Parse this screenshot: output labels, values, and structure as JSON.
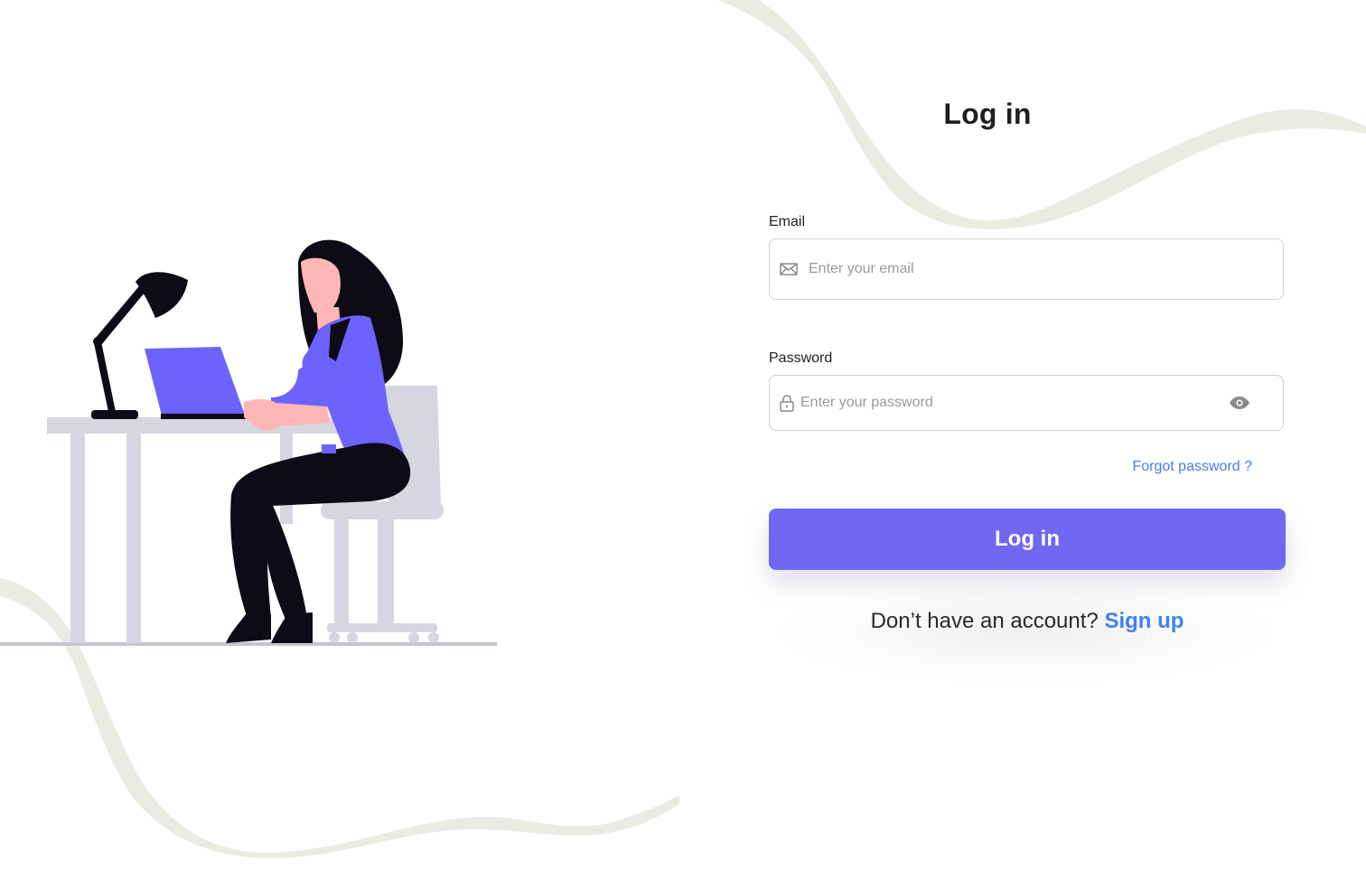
{
  "page": {
    "title": "Log in"
  },
  "form": {
    "email": {
      "label": "Email",
      "placeholder": "Enter your email",
      "value": "",
      "icon": "mail-icon"
    },
    "password": {
      "label": "Password",
      "placeholder": "Enter your password",
      "value": "",
      "icon": "lock-icon",
      "toggle_icon": "eye-icon"
    },
    "forgot_password": "Forgot password ?",
    "submit_label": "Log in",
    "signup_prompt": "Don’t have an account?",
    "signup_link": "Sign up"
  },
  "colors": {
    "primary_button": "#7067f2",
    "link": "#4a7cf0",
    "illustration_accent": "#6c63ff",
    "decor_wave": "#eaece4"
  }
}
